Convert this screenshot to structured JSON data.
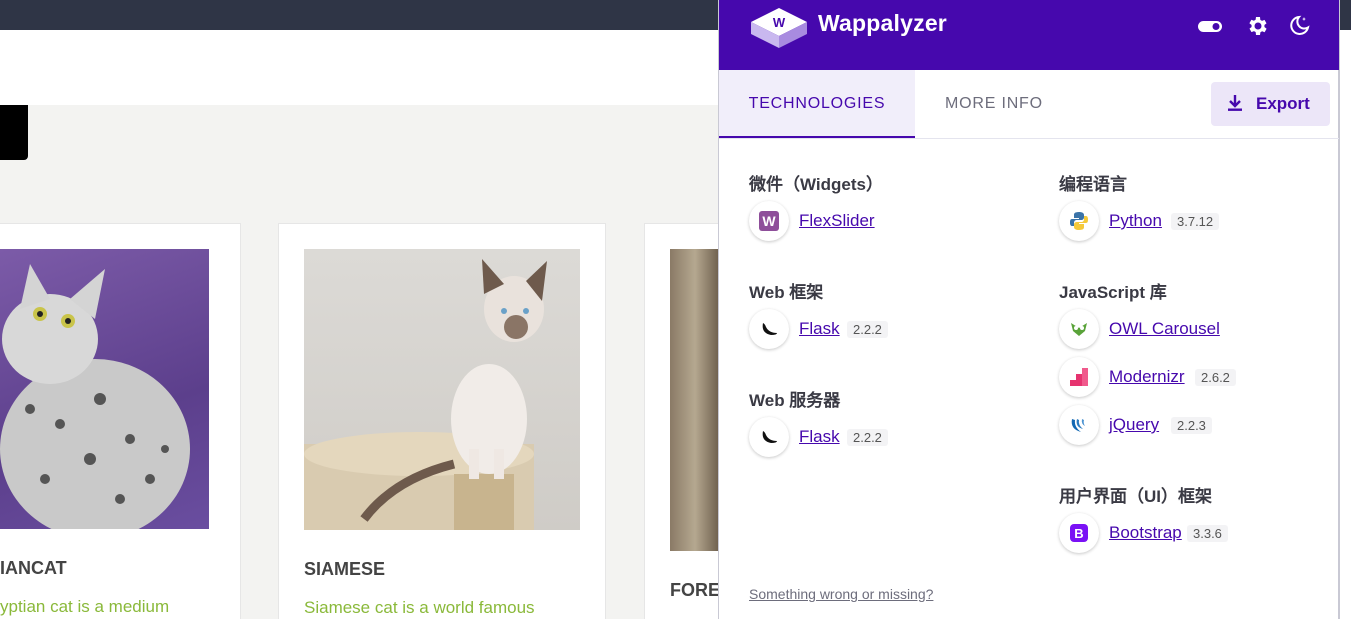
{
  "background_page": {
    "cards": [
      {
        "title": "IANCAT",
        "description": "yptian cat is a medium"
      },
      {
        "title": "SIAMESE",
        "description": "Siamese cat is a world famous"
      },
      {
        "title": "FORE",
        "description": ""
      }
    ]
  },
  "popup": {
    "brand": "Wappalyzer",
    "header_icons": [
      "toggle-icon",
      "gear-icon",
      "moon-icon"
    ],
    "tabs": [
      {
        "label": "TECHNOLOGIES",
        "active": true
      },
      {
        "label": "MORE INFO",
        "active": false
      }
    ],
    "export_label": "Export",
    "categories_left": [
      {
        "heading": "微件（Widgets）",
        "items": [
          {
            "name": "FlexSlider",
            "version": ""
          }
        ]
      },
      {
        "heading": "Web 框架",
        "items": [
          {
            "name": "Flask",
            "version": "2.2.2"
          }
        ]
      },
      {
        "heading": "Web 服务器",
        "items": [
          {
            "name": "Flask",
            "version": "2.2.2"
          }
        ]
      }
    ],
    "categories_right": [
      {
        "heading": "编程语言",
        "items": [
          {
            "name": "Python",
            "version": "3.7.12"
          }
        ]
      },
      {
        "heading": "JavaScript 库",
        "items": [
          {
            "name": "OWL Carousel",
            "version": ""
          },
          {
            "name": "Modernizr",
            "version": "2.6.2"
          },
          {
            "name": "jQuery",
            "version": "2.2.3"
          }
        ]
      },
      {
        "heading": "用户界面（UI）框架",
        "items": [
          {
            "name": "Bootstrap",
            "version": "3.3.6"
          }
        ]
      }
    ],
    "footer_link": "Something wrong or missing?",
    "colors": {
      "brand": "#4608ad",
      "accent_bg": "#ece6f8",
      "link": "#4608ad"
    }
  }
}
